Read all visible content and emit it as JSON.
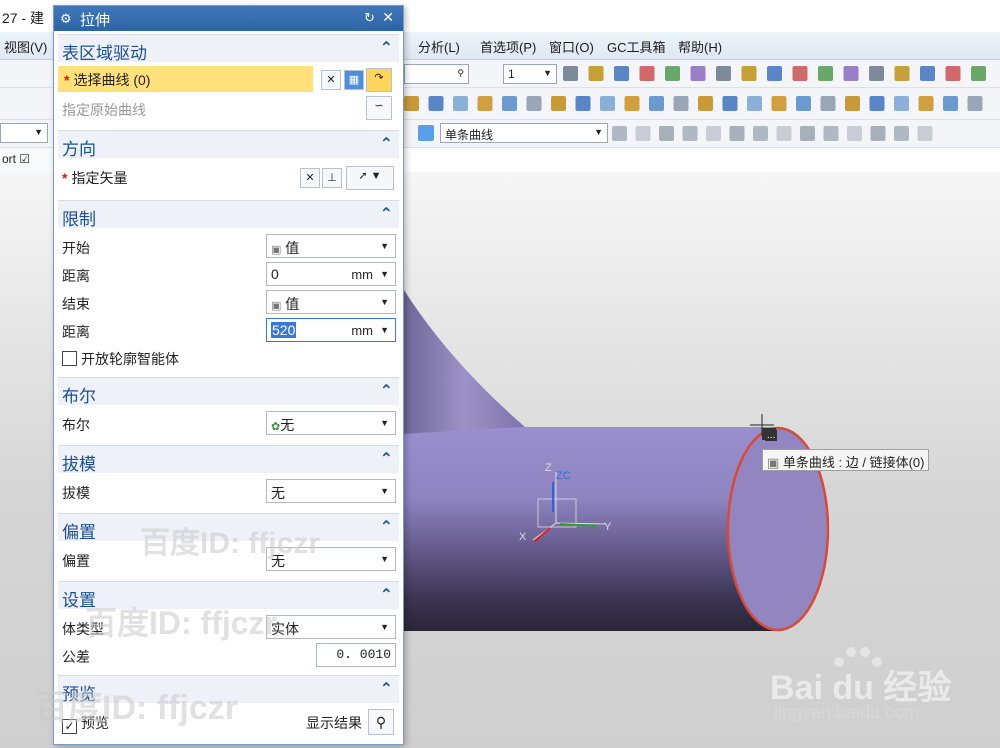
{
  "app": {
    "title_fragment": "27 - 建",
    "menus": [
      "视图(V)",
      "分析(L)",
      "首选项(P)",
      "窗口(O)",
      "GC工具箱",
      "帮助(H)"
    ],
    "tab_label": "ort",
    "toolbar_layer_value": "1",
    "selection_filter_value": "单条曲线"
  },
  "dialog": {
    "title": "拉伸",
    "sections": {
      "section_drive": {
        "title": "表区域驱动",
        "select_curve_label": "选择曲线 (0)",
        "original_curve_label": "指定原始曲线"
      },
      "direction": {
        "title": "方向",
        "vector_label": "指定矢量"
      },
      "limits": {
        "title": "限制",
        "start_label": "开始",
        "start_value": "值",
        "start_distance_label": "距离",
        "start_distance": "0",
        "end_label": "结束",
        "end_value": "值",
        "end_distance_label": "距离",
        "end_distance": "520",
        "unit": "mm",
        "open_profile_label": "开放轮廓智能体"
      },
      "boolean": {
        "title": "布尔",
        "label": "布尔",
        "value": "无"
      },
      "draft": {
        "title": "拔模",
        "label": "拔模",
        "value": "无"
      },
      "offset": {
        "title": "偏置",
        "label": "偏置",
        "value": "无"
      },
      "settings": {
        "title": "设置",
        "body_type_label": "体类型",
        "body_type_value": "实体",
        "tolerance_label": "公差",
        "tolerance_value": "0. 0010"
      },
      "preview": {
        "title": "预览",
        "preview_label": "预览",
        "show_result_label": "显示结果"
      }
    }
  },
  "viewport": {
    "tooltip": "单条曲线 : 边 / 链接体(0)",
    "axis_labels": {
      "z": "Z",
      "zc": "ZC",
      "x": "X",
      "y": "Y"
    },
    "tooltip_dots": "..."
  },
  "watermark": {
    "id_text": "百度ID: ffjczr",
    "baidu_logo": "Bai du 经验",
    "site": "jingyan.baidu.com"
  },
  "colors": {
    "accent": "#2c64a8",
    "section_title": "#1b4f93",
    "selected_row": "#ffe07a",
    "pipe": "#9386c0",
    "edge": "#d8493a"
  }
}
